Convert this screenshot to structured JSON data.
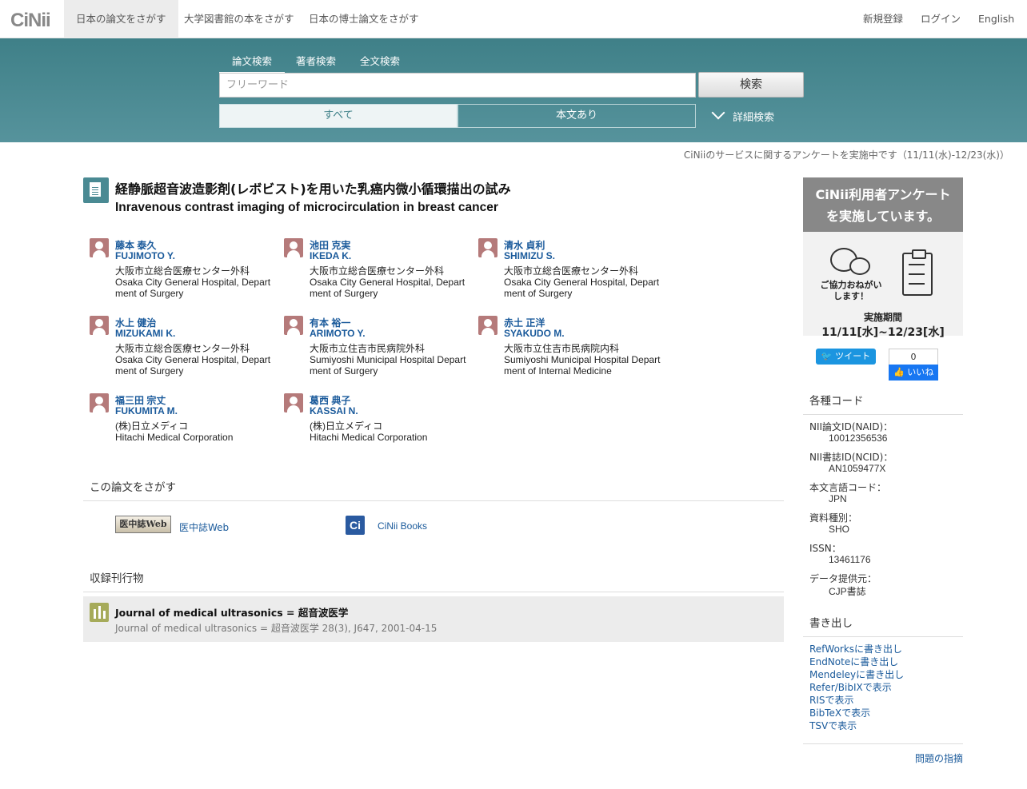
{
  "header": {
    "logo": "CiNii",
    "nav": [
      "日本の論文をさがす",
      "大学図書館の本をさがす",
      "日本の博士論文をさがす"
    ],
    "register": "新規登録",
    "login": "ログイン",
    "language": "English"
  },
  "search": {
    "tabs": [
      "論文検索",
      "著者検索",
      "全文検索"
    ],
    "placeholder": "フリーワード",
    "button": "検索",
    "filter_all": "すべて",
    "filter_fulltext": "本文あり",
    "advanced": "詳細検索"
  },
  "notice": "CiNiiのサービスに関するアンケートを実施中です（11/11(水)-12/23(水)）",
  "article": {
    "title_ja": "経静脈超音波造影剤(レボビスト)を用いた乳癌内微小循環描出の試み",
    "title_en": "Inravenous contrast imaging of microcirculation in breast cancer"
  },
  "authors": [
    {
      "name": "藤本 泰久",
      "roman": "FUJIMOTO Y.",
      "aff_ja": "大阪市立総合医療センター外科",
      "aff_en": "Osaka City General Hospital, Department of Surgery"
    },
    {
      "name": "池田 克実",
      "roman": "IKEDA K.",
      "aff_ja": "大阪市立総合医療センター外科",
      "aff_en": "Osaka City General Hospital, Department of Surgery"
    },
    {
      "name": "清水 貞利",
      "roman": "SHIMIZU S.",
      "aff_ja": "大阪市立総合医療センター外科",
      "aff_en": "Osaka City General Hospital, Department of Surgery"
    },
    {
      "name": "水上 健治",
      "roman": "MIZUKAMI K.",
      "aff_ja": "大阪市立総合医療センター外科",
      "aff_en": "Osaka City General Hospital, Department of Surgery"
    },
    {
      "name": "有本 裕一",
      "roman": "ARIMOTO Y.",
      "aff_ja": "大阪市立住吉市民病院外科",
      "aff_en": "Sumiyoshi Municipal Hospital Department of Surgery"
    },
    {
      "name": "赤土 正洋",
      "roman": "SYAKUDO M.",
      "aff_ja": "大阪市立住吉市民病院内科",
      "aff_en": "Sumiyoshi Municipal Hospital Department of Internal Medicine"
    },
    {
      "name": "福三田 宗丈",
      "roman": "FUKUMITA M.",
      "aff_ja": "(株)日立メディコ",
      "aff_en": "Hitachi Medical Corporation"
    },
    {
      "name": "葛西 典子",
      "roman": "KASSAI N.",
      "aff_ja": "(株)日立メディコ",
      "aff_en": "Hitachi Medical Corporation"
    }
  ],
  "find": {
    "heading": "この論文をさがす",
    "ichushi_badge": "医中誌Web",
    "ichushi_link": "医中誌Web",
    "cinii_badge": "Ci",
    "cinii_link": "CiNii Books"
  },
  "journal": {
    "heading": "収録刊行物",
    "title": "Journal of medical ultrasonics = 超音波医学",
    "citation": "Journal of medical ultrasonics = 超音波医学 28(3), J647, 2001-04-15"
  },
  "sidebar": {
    "banner_line1": "CiNii利用者アンケート",
    "banner_line2": "を実施しています。",
    "banner_msg": "ご協力おねがいします！",
    "banner_period_label": "実施期間",
    "banner_period": "11/11[水]~12/23[水]",
    "tweet": "ツイート",
    "fb_count": "0",
    "fb_like": "いいね",
    "codes_heading": "各種コード",
    "codes": [
      {
        "label": "NII論文ID(NAID)：",
        "value": "10012356536",
        "link": false
      },
      {
        "label": "NII書誌ID(NCID)：",
        "value": "AN1059477X",
        "link": true
      },
      {
        "label": "本文言語コード：",
        "value": "JPN",
        "link": false
      },
      {
        "label": "資料種別：",
        "value": "SHO",
        "link": false
      },
      {
        "label": "ISSN：",
        "value": "13461176",
        "link": false
      },
      {
        "label": "データ提供元：",
        "value": "CJP書誌",
        "link": false
      }
    ],
    "export_heading": "書き出し",
    "exports": [
      "RefWorksに書き出し",
      "EndNoteに書き出し",
      "Mendeleyに書き出し",
      "Refer/BibIXで表示",
      "RISで表示",
      "BibTeXで表示",
      "TSVで表示"
    ],
    "report": "問題の指摘"
  }
}
